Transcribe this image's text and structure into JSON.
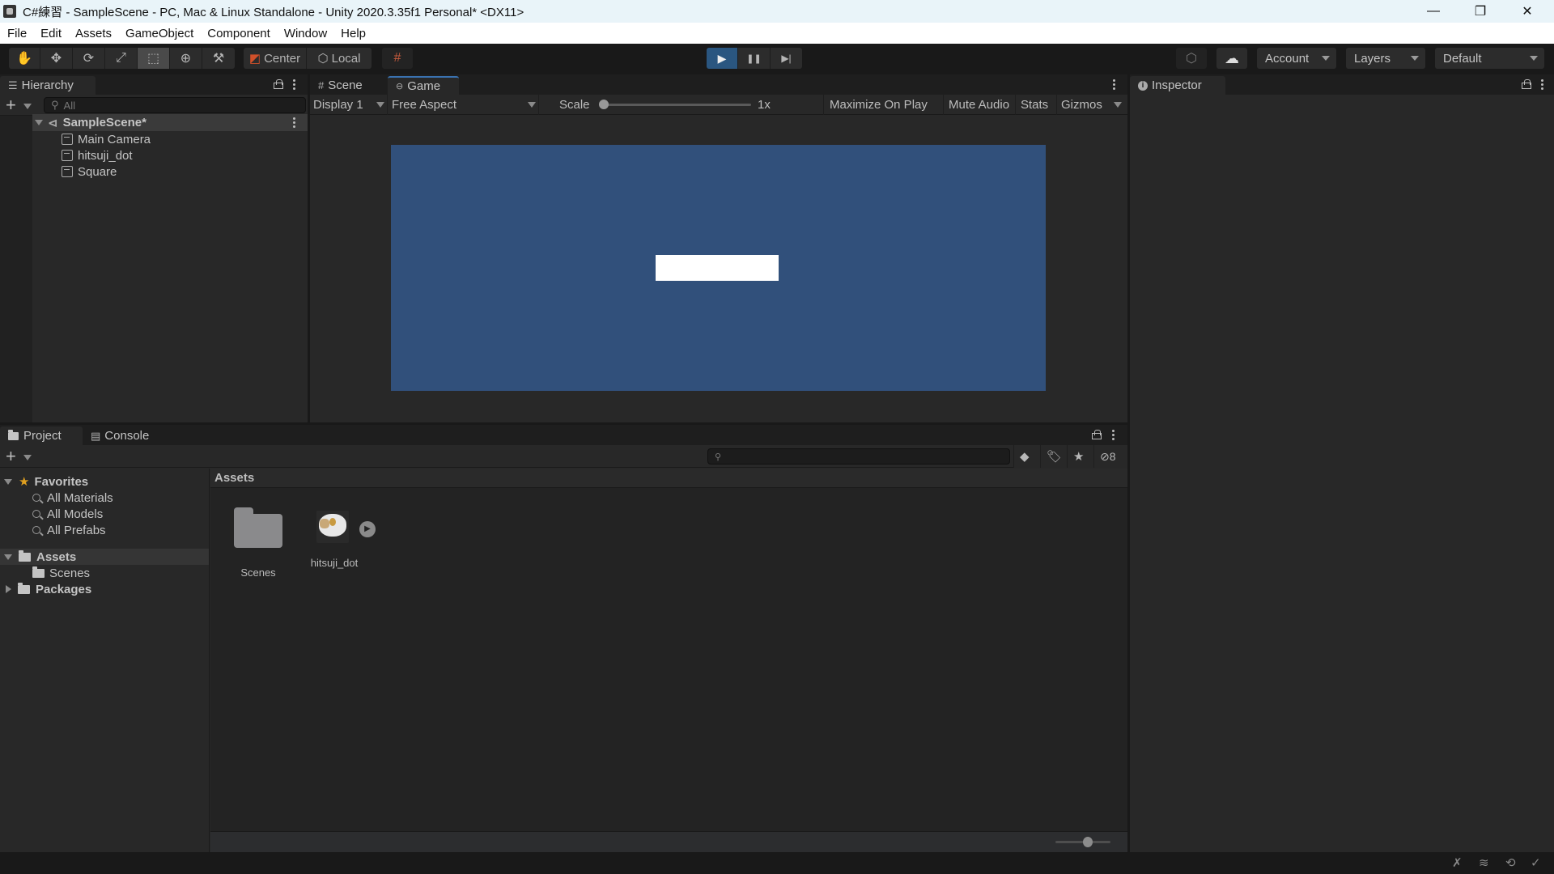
{
  "window": {
    "title": "C#練習 - SampleScene - PC, Mac & Linux Standalone - Unity 2020.3.35f1 Personal* <DX11>",
    "controls": {
      "minimize": "—",
      "restore": "❐",
      "close": "✕"
    }
  },
  "menu": [
    "File",
    "Edit",
    "Assets",
    "GameObject",
    "Component",
    "Window",
    "Help"
  ],
  "toolbar": {
    "tools": [
      {
        "name": "hand-tool",
        "glyph": "✋",
        "active": false
      },
      {
        "name": "move-tool",
        "glyph": "✥",
        "active": false
      },
      {
        "name": "rotate-tool",
        "glyph": "⟳",
        "active": false
      },
      {
        "name": "scale-tool",
        "glyph": "⤢",
        "active": false
      },
      {
        "name": "rect-tool",
        "glyph": "⬚",
        "active": true
      },
      {
        "name": "transform-tool",
        "glyph": "⊕",
        "active": false
      },
      {
        "name": "custom-tool",
        "glyph": "⚒",
        "active": false
      }
    ],
    "pivot_label": "Center",
    "space_label": "Local",
    "snap_glyph": "#",
    "play_glyph": "▶",
    "pause_glyph": "❚❚",
    "step_glyph": "▶|",
    "collab_glyph": "⬡",
    "cloud_glyph": "☁",
    "account_label": "Account",
    "layers_label": "Layers",
    "layout_label": "Default"
  },
  "hierarchy": {
    "tab_label": "Hierarchy",
    "search_placeholder": "All",
    "scene": "SampleScene*",
    "items": [
      "Main Camera",
      "hitsuji_dot",
      "Square"
    ]
  },
  "game_view": {
    "tabs": [
      {
        "label": "Scene",
        "icon": "#"
      },
      {
        "label": "Game",
        "icon": "🎮"
      }
    ],
    "display": "Display 1",
    "aspect": "Free Aspect",
    "scale_label": "Scale",
    "scale_value": "1x",
    "scale_fraction": 0.0,
    "maximize_label": "Maximize On Play",
    "mute_label": "Mute Audio",
    "stats_label": "Stats",
    "gizmos_label": "Gizmos",
    "background_color": "#31507b",
    "square_color": "#ffffff"
  },
  "inspector": {
    "tab_label": "Inspector",
    "tab_icon": "i"
  },
  "project": {
    "tabs": [
      {
        "label": "Project"
      },
      {
        "label": "Console"
      }
    ],
    "favorites_label": "Favorites",
    "favorites": [
      "All Materials",
      "All Models",
      "All Prefabs"
    ],
    "assets_label": "Assets",
    "assets_children": [
      "Scenes"
    ],
    "packages_label": "Packages",
    "breadcrumb": "Assets",
    "grid_items": [
      {
        "label": "Scenes",
        "type": "folder"
      },
      {
        "label": "hitsuji_dot",
        "type": "sprite"
      }
    ],
    "hidden_count": "8",
    "zoom_fraction": 0.6
  },
  "status_icons": [
    "debug-off-icon",
    "cache-off-icon",
    "auto-refresh-off-icon",
    "progress-check-icon"
  ]
}
